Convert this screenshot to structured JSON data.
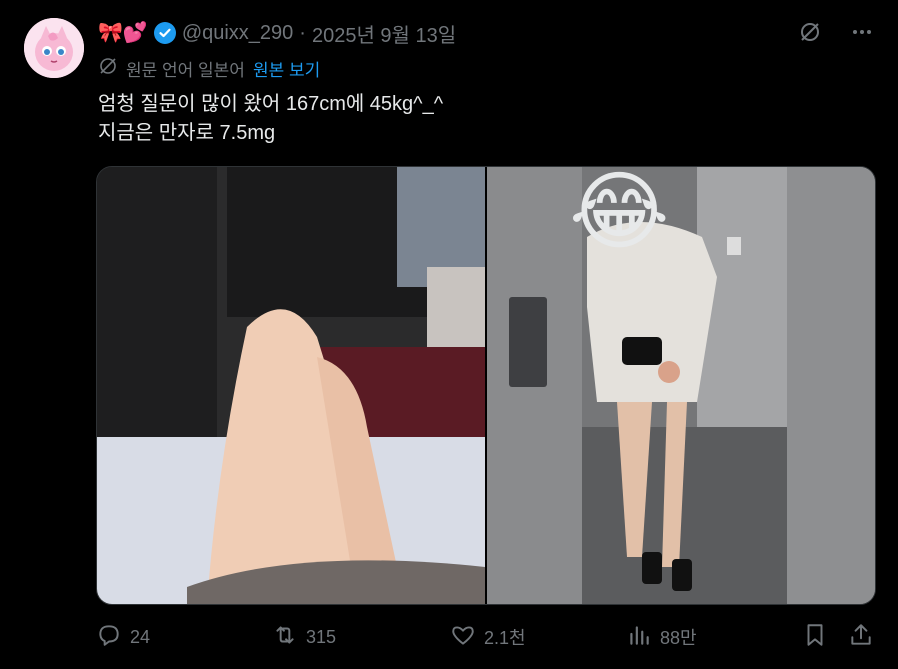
{
  "tweet": {
    "name_emojis": "🎀💕",
    "handle": "@quixx_290",
    "separator": "·",
    "date": "2025년 9월 13일",
    "translation": {
      "note": "원문 언어 일본어",
      "link": "원본 보기"
    },
    "text_line1": "엄청 질문이 많이 왔어 167cm에 45kg^_^",
    "text_line2": "지금은 만자로 7.5mg",
    "overlay_emoji": "😂"
  },
  "actions": {
    "replies": "24",
    "retweets": "315",
    "likes": "2.1천",
    "views": "88만"
  },
  "colors": {
    "background": "#000000",
    "text": "#e7e9ea",
    "muted": "#71767b",
    "accent": "#1d9bf0"
  },
  "icons": [
    "verified-badge-icon",
    "grok-slash-icon",
    "more-icon",
    "translate-icon",
    "reply-icon",
    "retweet-icon",
    "like-icon",
    "views-icon",
    "bookmark-icon",
    "share-icon"
  ]
}
